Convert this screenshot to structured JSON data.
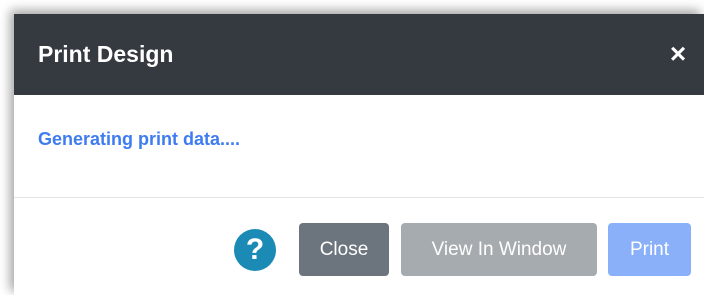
{
  "dialog": {
    "title": "Print Design",
    "close_icon": "close-icon",
    "status_text": "Generating print data....",
    "help_icon": "question-icon",
    "help_symbol": "?",
    "buttons": {
      "close_label": "Close",
      "view_label": "View In Window",
      "print_label": "Print"
    }
  },
  "colors": {
    "header_bg": "#343a40",
    "status_text": "#3e7cf0",
    "help_bg": "#1b8bb5",
    "close_btn": "#6c757d",
    "view_btn_disabled": "#a6abb0",
    "print_btn_disabled": "#8ab0fa"
  }
}
